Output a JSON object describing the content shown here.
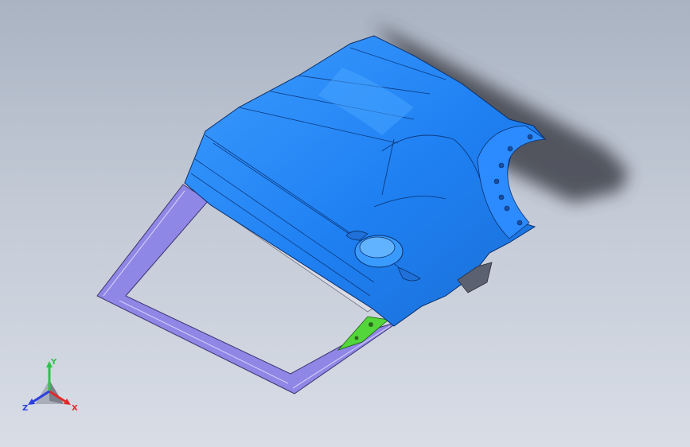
{
  "viewport": {
    "background_top": "#a9b3c2",
    "background_bottom": "#d8dde6"
  },
  "model": {
    "body_color": "#1f7ff0",
    "body_highlight": "#47a4ff",
    "frame_color": "#8f87e6",
    "bracket_color": "#53d63a",
    "shadow_color": "#3f434b"
  },
  "triad": {
    "labels": {
      "x": "X",
      "y": "Y",
      "z": "Z"
    },
    "colors": {
      "x": "#e02a2a",
      "y": "#2fc24a",
      "z": "#2b3fe0"
    }
  }
}
